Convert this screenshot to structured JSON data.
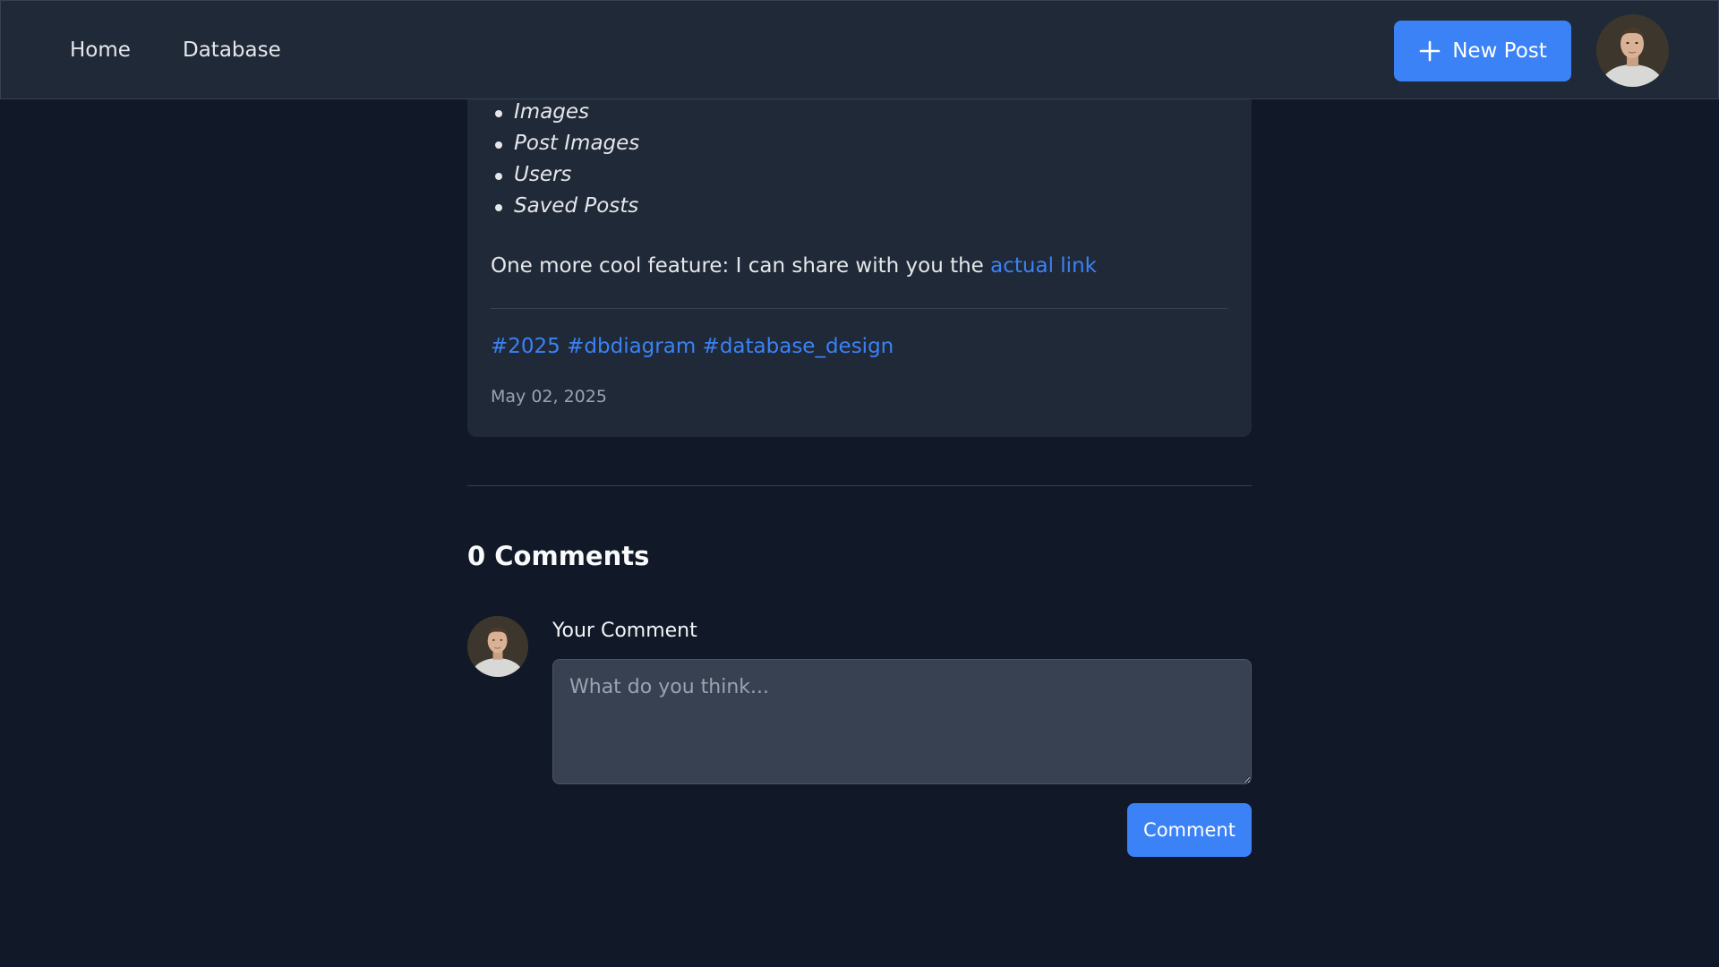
{
  "nav": {
    "links": [
      "Home",
      "Database"
    ],
    "new_post_label": "New Post"
  },
  "post": {
    "table_items": [
      "Images",
      "Post Images",
      "Users",
      "Saved Posts"
    ],
    "feature_text": "One more cool feature: I can share with you the ",
    "feature_link": "actual link",
    "tags": [
      "#2025",
      "#dbdiagram",
      "#database_design"
    ],
    "date": "May 02, 2025"
  },
  "comments": {
    "heading": "0 Comments",
    "label": "Your Comment",
    "placeholder": "What do you think...",
    "submit_label": "Comment"
  },
  "colors": {
    "background": "#111827",
    "surface": "#1f2937",
    "accent": "#3b82f6"
  },
  "icons": {
    "new_post": "plus-icon",
    "user": "avatar"
  }
}
